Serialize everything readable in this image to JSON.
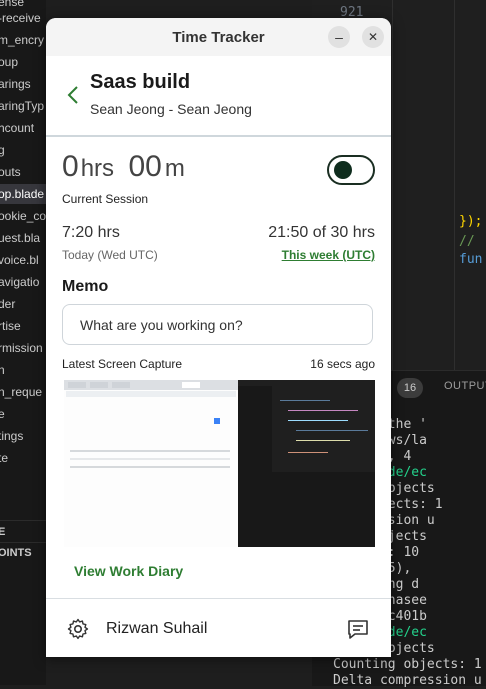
{
  "background": {
    "explorer_items": [
      "-receive",
      "m_encry",
      "oup",
      "arings",
      "aringTyp",
      "hcount",
      "g",
      "outs",
      "op.blade",
      "ookie_co",
      "uest.bla",
      "voice.bl",
      "avigatio",
      "der",
      "rtise",
      "rmission",
      "n",
      "n_reque",
      "e",
      "tings",
      "te"
    ],
    "explorer_top_partial": "ense",
    "explorer_footer_1": "E",
    "explorer_footer_2": "OINTS",
    "line_number": "921",
    "code_line_1": "});",
    "code_line_2": "//",
    "code_line_3": "fun",
    "panel_badge": "16",
    "panel_tab": "OUTPUT",
    "terminal_lines": [
      "ade by the '",
      "ces/views/la",
      " changed, 4",
      "ar:~/code/ec",
      "nting objects",
      "ing objects: 1",
      "compression u",
      "sing objects",
      " objects: 10",
      " (delta 5),",
      " Resolving d",
      "ub.com:hasee",
      "b3f..0fc401b",
      "ar:~/code/ec",
      "nting objects",
      "Counting objects: 1",
      "Delta compression u"
    ]
  },
  "app": {
    "title": "Time Tracker",
    "minimize_label": "–",
    "close_label": "✕",
    "back_label": "‹",
    "project_title": "Saas build",
    "project_subtitle": "Sean Jeong - Sean Jeong",
    "timer_hours": "0",
    "timer_hours_unit": "hrs",
    "timer_minutes": "00",
    "timer_minutes_unit": "m",
    "current_session_label": "Current Session",
    "tracking_on": false,
    "today_hours": "7:20 hrs",
    "today_label": "Today (Wed UTC)",
    "week_hours": "21:50 of 30 hrs",
    "week_link": "This week (UTC)",
    "memo_heading": "Memo",
    "memo_placeholder": "What are you working on?",
    "capture_label": "Latest Screen Capture",
    "capture_time": "16 secs ago",
    "view_diary_label": "View Work Diary",
    "user_name": "Rizwan Suhail",
    "icons": {
      "settings": "gear-icon",
      "feedback": "chat-icon",
      "back": "chevron-left-icon"
    },
    "colors": {
      "accent": "#2e7d32",
      "toggle": "#0f2d1e"
    }
  }
}
